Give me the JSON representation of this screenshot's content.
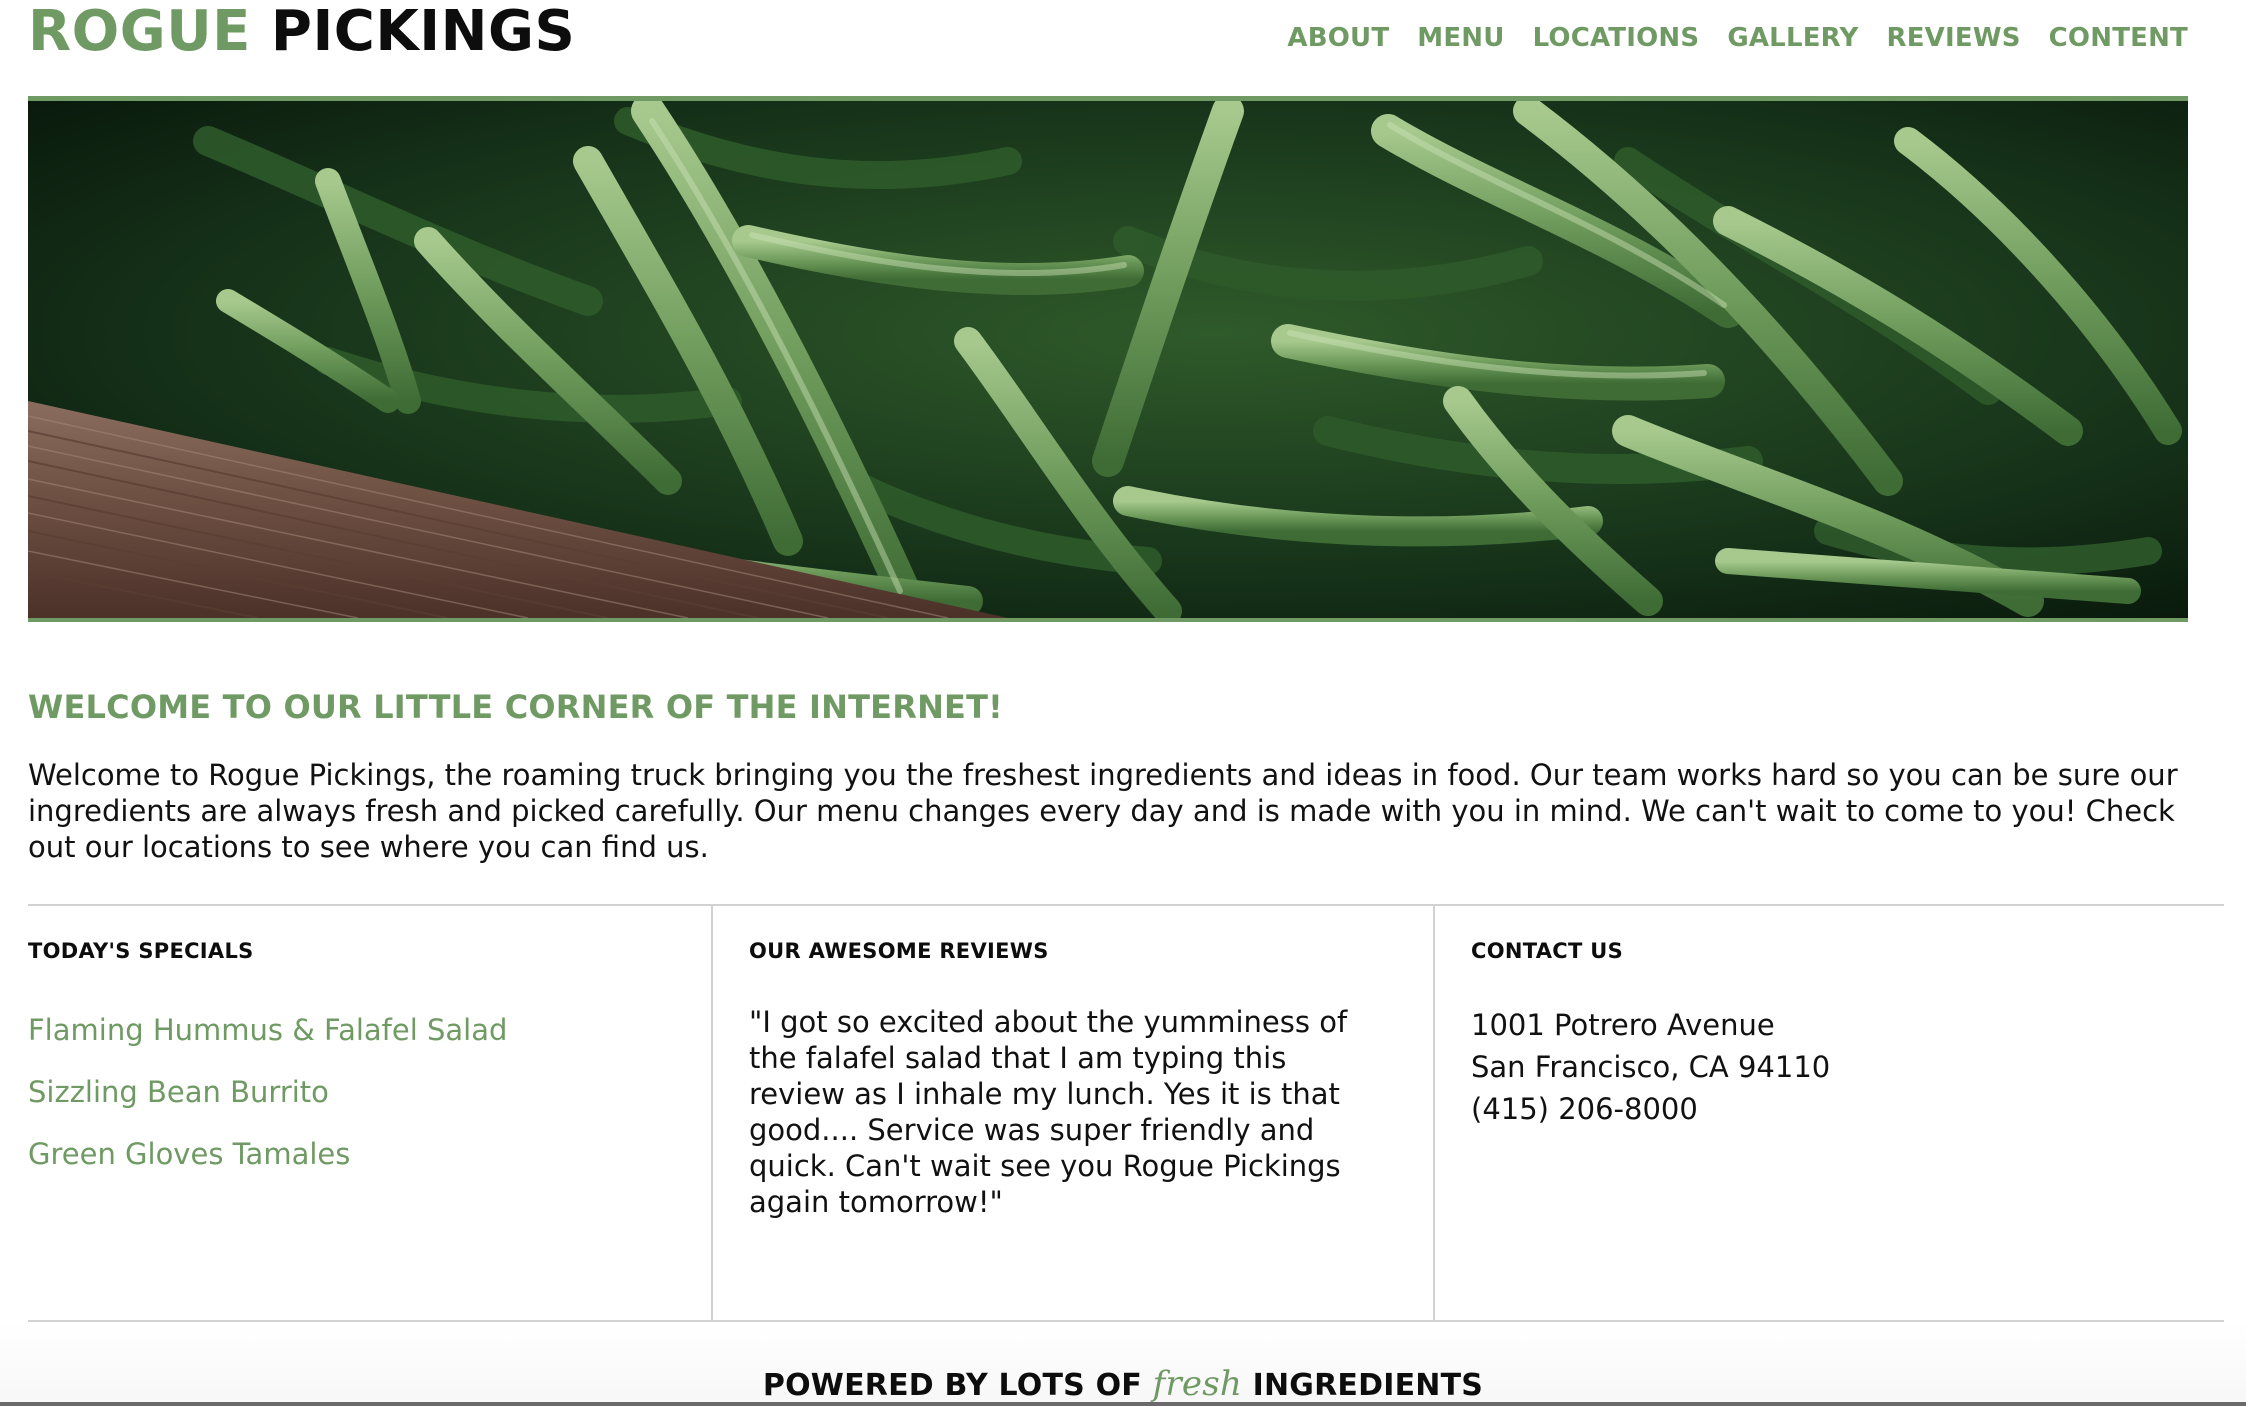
{
  "brand": {
    "first": "ROGUE",
    "second": "PICKINGS",
    "accent_color": "#6f9a63",
    "text_color": "#0d0d0d"
  },
  "nav": {
    "items": [
      "ABOUT",
      "MENU",
      "LOCATIONS",
      "GALLERY",
      "REVIEWS",
      "CONTENT"
    ]
  },
  "hero": {
    "image_subject": "green-beans-in-wooden-crate"
  },
  "welcome": {
    "title": "WELCOME TO OUR LITTLE CORNER OF THE INTERNET!",
    "body": "Welcome to Rogue Pickings, the roaming truck bringing you the freshest ingredients and ideas in food. Our team works hard so you can be sure our ingredients are always fresh and picked carefully. Our menu changes every day and is made with you in mind. We can't wait to come to you! Check out our locations to see where you can find us."
  },
  "specials": {
    "heading": "TODAY'S SPECIALS",
    "items": [
      "Flaming Hummus & Falafel Salad",
      "Sizzling Bean Burrito",
      "Green Gloves Tamales"
    ]
  },
  "reviews": {
    "heading": "OUR AWESOME REVIEWS",
    "text": "\"I got so excited about the yumminess of the falafel salad that I am typing this review as I inhale my lunch. Yes it is that good.... Service was super friendly and quick. Can't wait see you Rogue Pickings again tomorrow!\""
  },
  "contact": {
    "heading": "CONTACT US",
    "street": "1001 Potrero Avenue",
    "city": "San Francisco, CA 94110",
    "phone": "(415) 206-8000"
  },
  "footer": {
    "before": "POWERED BY LOTS OF",
    "emphasis": "fresh",
    "after": "INGREDIENTS"
  }
}
